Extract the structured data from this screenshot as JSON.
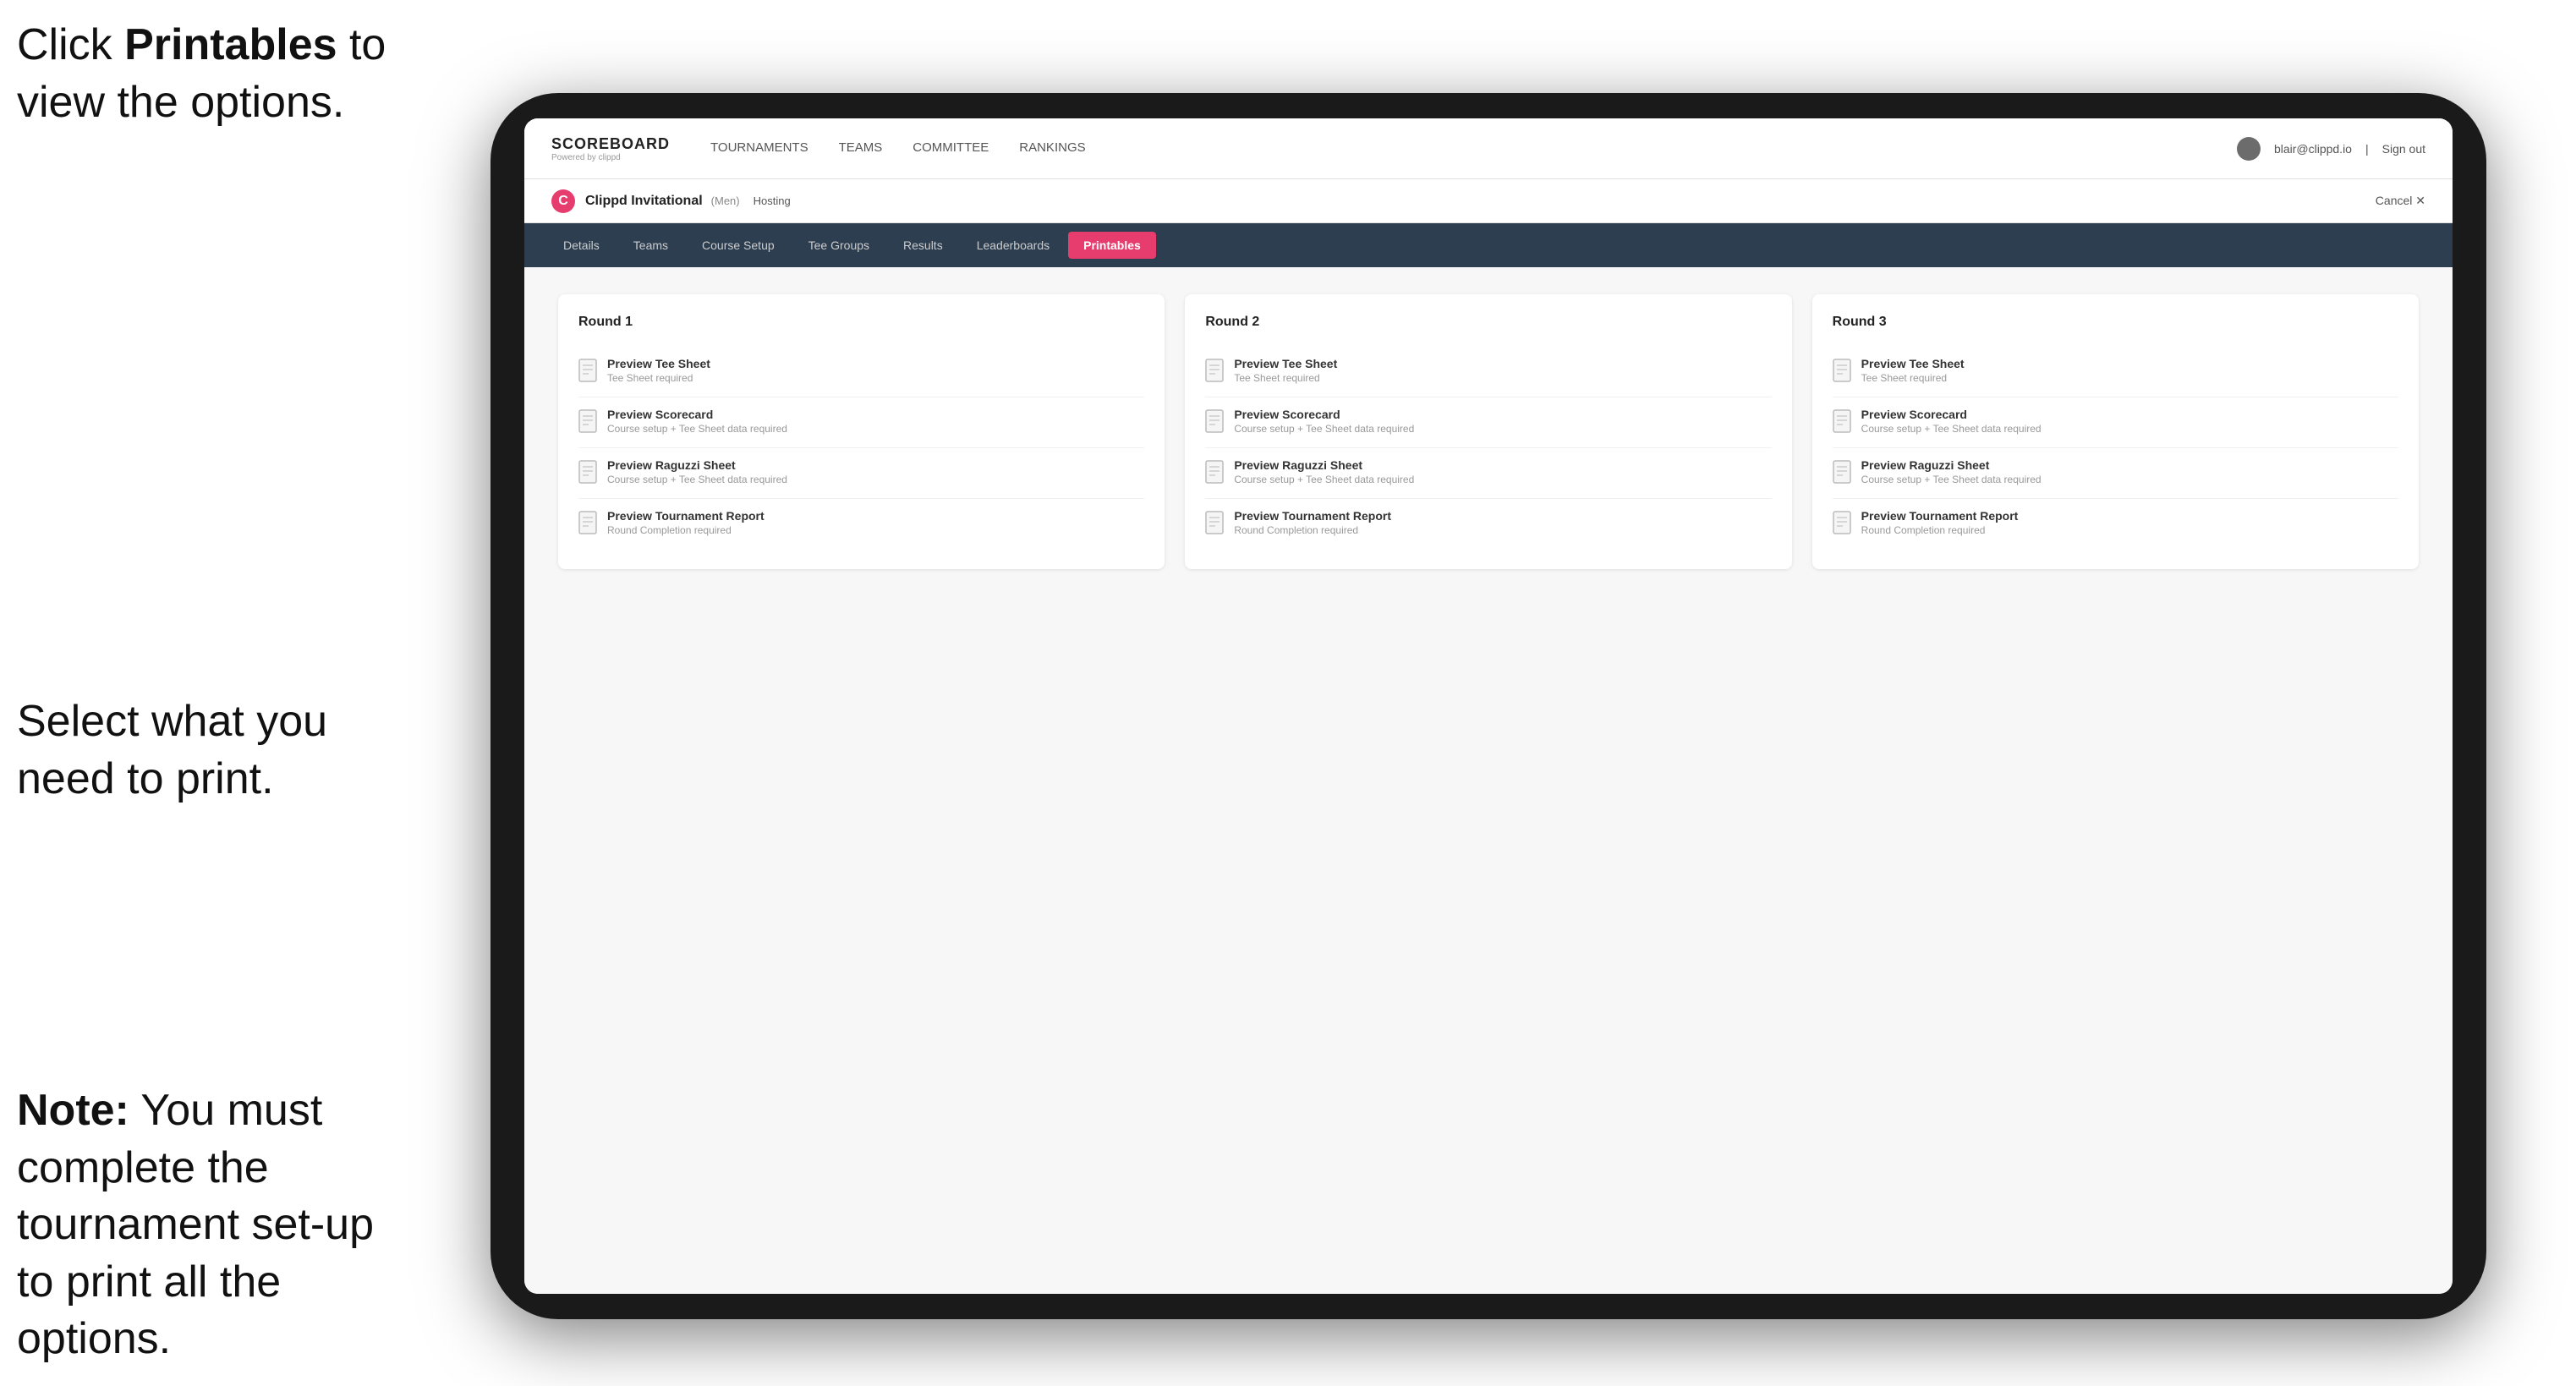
{
  "annotations": {
    "top": {
      "prefix": "Click ",
      "bold": "Printables",
      "suffix": " to\nview the options."
    },
    "middle": {
      "text": "Select what you\nneed to print."
    },
    "bottom": {
      "bold_prefix": "Note:",
      "suffix": " You must\ncomplete the\ntournament set-up\nto print all the options."
    }
  },
  "nav": {
    "logo": "SCOREBOARD",
    "logo_sub": "Powered by clippd",
    "links": [
      {
        "label": "TOURNAMENTS",
        "active": false
      },
      {
        "label": "TEAMS",
        "active": false
      },
      {
        "label": "COMMITTEE",
        "active": false
      },
      {
        "label": "RANKINGS",
        "active": false
      }
    ],
    "user_email": "blair@clippd.io",
    "sign_out": "Sign out"
  },
  "tournament": {
    "logo_letter": "C",
    "name": "Clippd Invitational",
    "tag": "(Men)",
    "status": "Hosting",
    "cancel": "Cancel ✕"
  },
  "tabs": [
    {
      "label": "Details",
      "active": false
    },
    {
      "label": "Teams",
      "active": false
    },
    {
      "label": "Course Setup",
      "active": false
    },
    {
      "label": "Tee Groups",
      "active": false
    },
    {
      "label": "Results",
      "active": false
    },
    {
      "label": "Leaderboards",
      "active": false
    },
    {
      "label": "Printables",
      "active": true
    }
  ],
  "rounds": [
    {
      "title": "Round 1",
      "items": [
        {
          "title": "Preview Tee Sheet",
          "sub": "Tee Sheet required"
        },
        {
          "title": "Preview Scorecard",
          "sub": "Course setup + Tee Sheet data required"
        },
        {
          "title": "Preview Raguzzi Sheet",
          "sub": "Course setup + Tee Sheet data required"
        },
        {
          "title": "Preview Tournament Report",
          "sub": "Round Completion required"
        }
      ]
    },
    {
      "title": "Round 2",
      "items": [
        {
          "title": "Preview Tee Sheet",
          "sub": "Tee Sheet required"
        },
        {
          "title": "Preview Scorecard",
          "sub": "Course setup + Tee Sheet data required"
        },
        {
          "title": "Preview Raguzzi Sheet",
          "sub": "Course setup + Tee Sheet data required"
        },
        {
          "title": "Preview Tournament Report",
          "sub": "Round Completion required"
        }
      ]
    },
    {
      "title": "Round 3",
      "items": [
        {
          "title": "Preview Tee Sheet",
          "sub": "Tee Sheet required"
        },
        {
          "title": "Preview Scorecard",
          "sub": "Course setup + Tee Sheet data required"
        },
        {
          "title": "Preview Raguzzi Sheet",
          "sub": "Course setup + Tee Sheet data required"
        },
        {
          "title": "Preview Tournament Report",
          "sub": "Round Completion required"
        }
      ]
    }
  ],
  "colors": {
    "accent": "#e63c6e",
    "tab_bg": "#2c3e50"
  }
}
